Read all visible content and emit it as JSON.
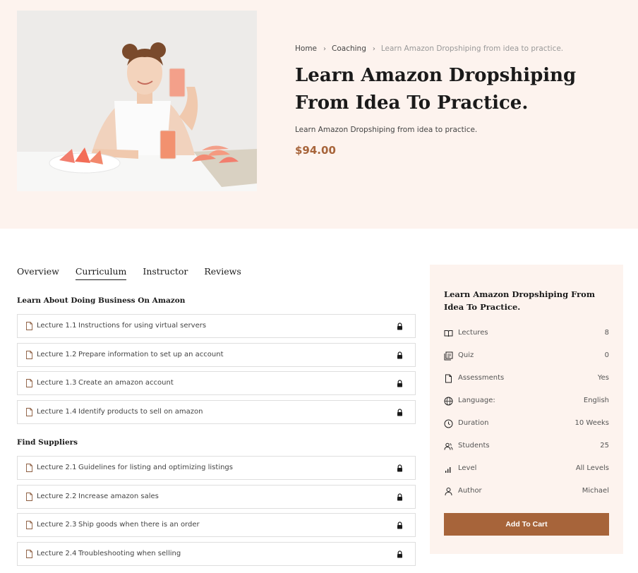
{
  "breadcrumb": {
    "home": "Home",
    "category": "Coaching",
    "current": "Learn Amazon Dropshiping from idea to practice."
  },
  "course": {
    "title": "Learn Amazon Dropshiping From Idea To Practice.",
    "subtitle": "Learn Amazon Dropshiping from idea to practice.",
    "price": "$94.00"
  },
  "tabs": [
    "Overview",
    "Curriculum",
    "Instructor",
    "Reviews"
  ],
  "active_tab": "Curriculum",
  "curriculum": [
    {
      "title": "Learn About Doing Business On Amazon",
      "lectures": [
        {
          "num": "Lecture 1.1",
          "name": "Instructions for using virtual servers"
        },
        {
          "num": "Lecture 1.2",
          "name": "Prepare information to set up an account"
        },
        {
          "num": "Lecture 1.3",
          "name": "Create an amazon account"
        },
        {
          "num": "Lecture 1.4",
          "name": "Identify products to sell on amazon"
        }
      ]
    },
    {
      "title": "Find Suppliers",
      "lectures": [
        {
          "num": "Lecture 2.1",
          "name": "Guidelines for listing and optimizing listings"
        },
        {
          "num": "Lecture 2.2",
          "name": "Increase amazon sales"
        },
        {
          "num": "Lecture 2.3",
          "name": "Ship goods when there is an order"
        },
        {
          "num": "Lecture 2.4",
          "name": "Troubleshooting when selling"
        }
      ]
    }
  ],
  "sidebar": {
    "title": "Learn Amazon Dropshiping From Idea To Practice.",
    "rows": [
      {
        "icon": "book-icon",
        "label": "Lectures",
        "value": "8"
      },
      {
        "icon": "quiz-icon",
        "label": "Quiz",
        "value": "0"
      },
      {
        "icon": "file-icon",
        "label": "Assessments",
        "value": "Yes"
      },
      {
        "icon": "globe-icon",
        "label": "Language:",
        "value": "English"
      },
      {
        "icon": "clock-icon",
        "label": "Duration",
        "value": "10 Weeks"
      },
      {
        "icon": "users-icon",
        "label": "Students",
        "value": "25"
      },
      {
        "icon": "signal-icon",
        "label": "Level",
        "value": "All Levels"
      },
      {
        "icon": "user-icon",
        "label": "Author",
        "value": "Michael"
      }
    ],
    "cta": "Add To Cart"
  },
  "colors": {
    "accent": "#a7643a",
    "hero_bg": "#fdf3ee",
    "sidebar_bg": "#fdf3ee",
    "border": "#dedede"
  }
}
